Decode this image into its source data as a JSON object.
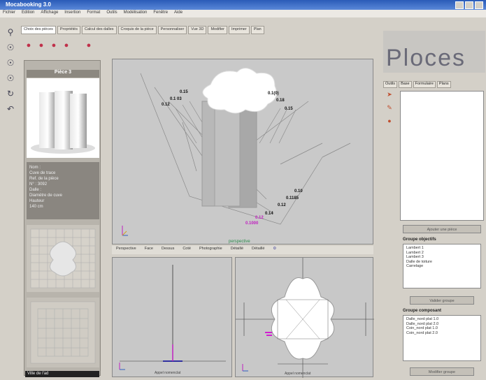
{
  "window": {
    "title": "Mocabooking 3.0"
  },
  "menu": [
    "Fichier",
    "Edition",
    "Affichage",
    "Insertion",
    "Format",
    "Outils",
    "Modélisation",
    "Fenêtre",
    "Aide"
  ],
  "tabs": [
    "Choix des pièces",
    "Propriétés",
    "Calcul des dalles",
    "Croquis de la pièce",
    "Personnaliser",
    "Vue 3D",
    "Modifier",
    "Imprimer",
    "Plan"
  ],
  "left_panel": {
    "piece_title": "Pièce 3",
    "info_lines": [
      "Nom :",
      "Cuve de trace",
      "Ref. de la pièce",
      "N° : 3092",
      "Dalle :",
      "Diamètre de cuve",
      "Hauteur",
      "140 cm"
    ],
    "status": "Ville de l'ad"
  },
  "view3d": {
    "labels": [
      "0.15",
      "0.1 03",
      "0.12",
      "0.1(0)",
      "0.18",
      "0.15",
      "0.10",
      "0.1185",
      "0.12",
      "0.14",
      "0.12",
      "0.1000"
    ],
    "bottom_label": "perspective"
  },
  "view_toolbar": [
    "Perspective",
    "Face",
    "Dessus",
    "Coté",
    "Photographie",
    "Détaillé",
    "Détaillé"
  ],
  "viewL": {
    "caption": "Appel nomenclat"
  },
  "viewR": {
    "caption": "Appel nomenclat"
  },
  "right_panel": {
    "logo": "Ploces",
    "tabs": [
      "Outils",
      "Base",
      "Formulaire",
      "Plans"
    ],
    "button1": "Ajouter une pièce",
    "group1_label": "Groupe objectifs",
    "group1_items": [
      "Lambert 1",
      "Lambert 2",
      "Lambert 3",
      "Dalle de toiture",
      "Carrelage"
    ],
    "button2": "Valider groupe",
    "group2_label": "Groupe composant",
    "group2_items": [
      "Dalle_nord plat 1.0",
      "Dalle_nord plat 2.0",
      "Coin_nord plat 1.0",
      "Coin_nord plat 2.0"
    ],
    "button3": "Modifier groupe"
  },
  "colors": {
    "titlebar": "#3a6bc8",
    "accent": "#c0304a",
    "highlight": "#d020d0"
  }
}
